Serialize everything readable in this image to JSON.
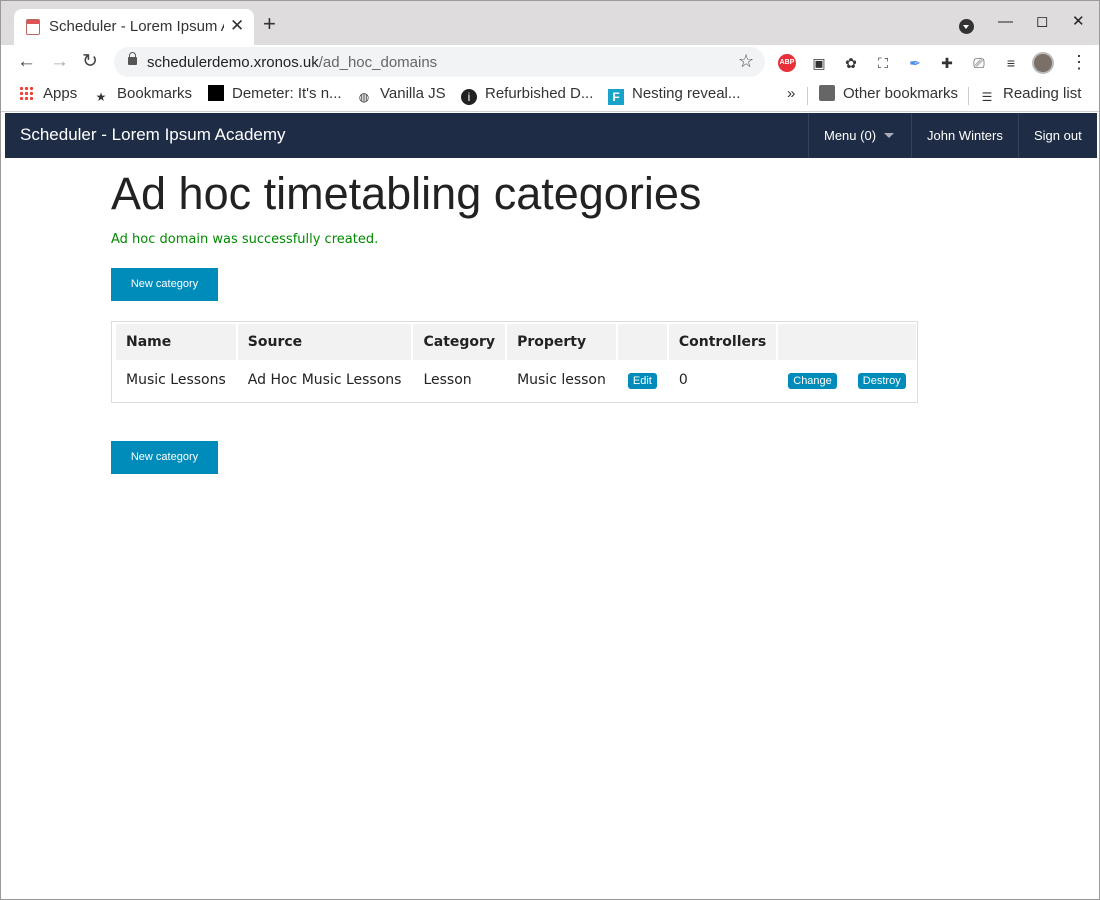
{
  "browser": {
    "tab_title": "Scheduler - Lorem Ipsum Academy",
    "url_host": "schedulerdemo.xronos.uk",
    "url_path": "/ad_hoc_domains",
    "bookmarks": [
      {
        "label": "Apps",
        "icon": "apps-grid-icon"
      },
      {
        "label": "Bookmarks",
        "icon": "star-icon"
      },
      {
        "label": "Demeter: It's n...",
        "icon": "black-square-icon"
      },
      {
        "label": "Vanilla JS",
        "icon": "globe-icon"
      },
      {
        "label": "Refurbished D...",
        "icon": "dark-circle-icon"
      },
      {
        "label": "Nesting reveal...",
        "icon": "teal-f-icon"
      }
    ],
    "overflow": "»",
    "other_bookmarks": "Other bookmarks",
    "reading_list": "Reading list"
  },
  "site": {
    "title": "Scheduler - Lorem Ipsum Academy",
    "menu_label": "Menu (0)",
    "user_name": "John Winters",
    "sign_out": "Sign out"
  },
  "page": {
    "heading": "Ad hoc timetabling categories",
    "notice": "Ad hoc domain was successfully created.",
    "new_category_label": "New category"
  },
  "table": {
    "headers": [
      "Name",
      "Source",
      "Category",
      "Property",
      "",
      "Controllers",
      ""
    ],
    "rows": [
      {
        "name": "Music Lessons",
        "source": "Ad Hoc Music Lessons",
        "category": "Lesson",
        "property": "Music lesson",
        "edit_label": "Edit",
        "controllers": "0",
        "change_label": "Change",
        "destroy_label": "Destroy"
      }
    ]
  },
  "colors": {
    "navbar": "#1f2c45",
    "button": "#008cba",
    "notice": "#008a00"
  }
}
